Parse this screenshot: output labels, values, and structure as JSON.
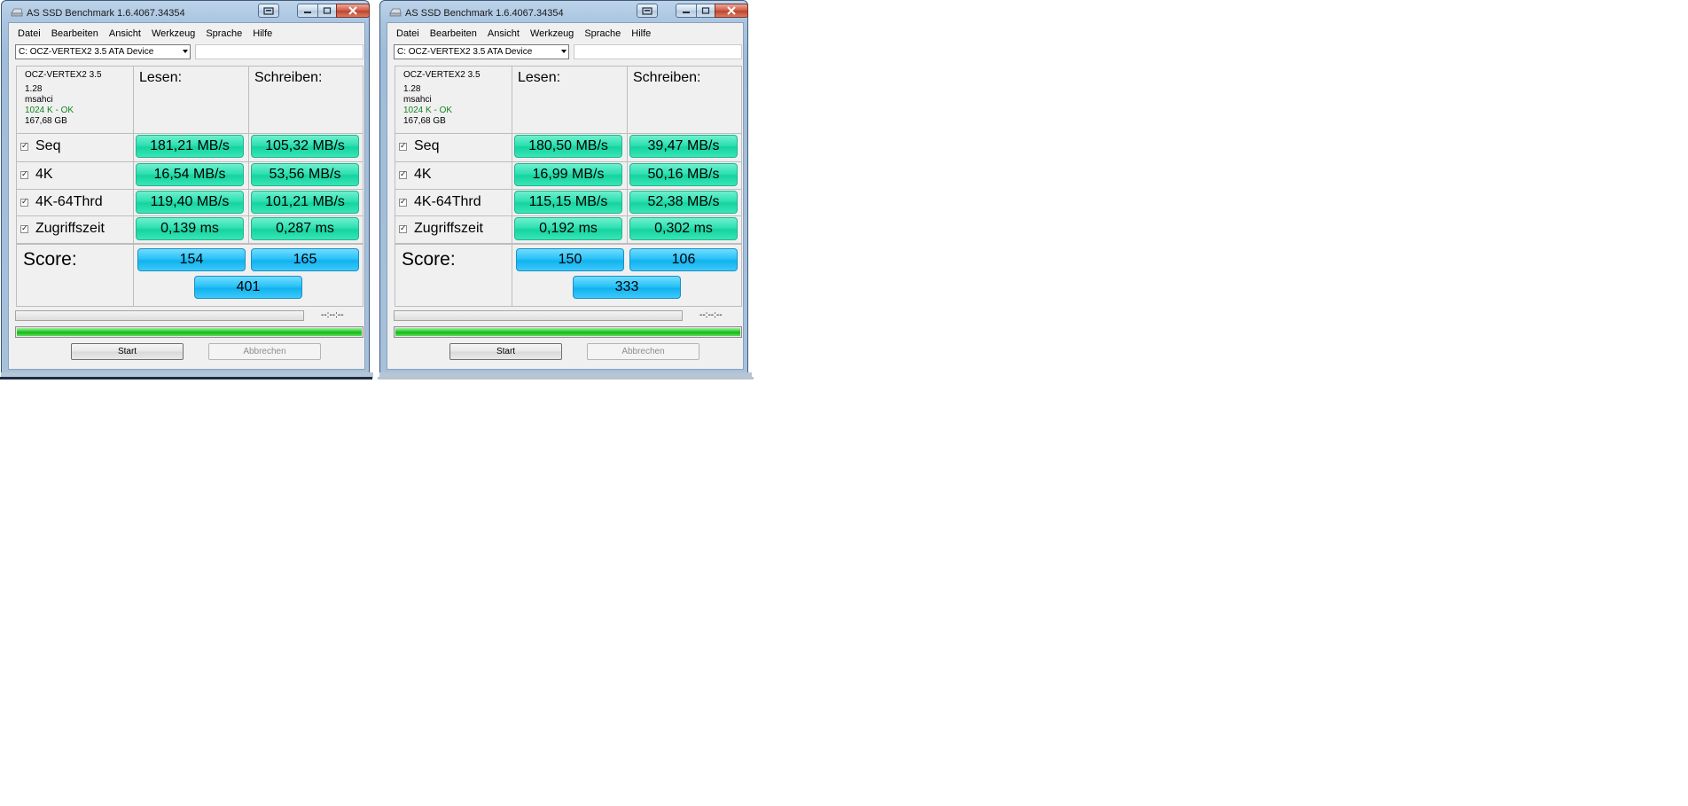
{
  "windows": [
    {
      "title": "AS SSD Benchmark 1.6.4067.34354",
      "menu": [
        "Datei",
        "Bearbeiten",
        "Ansicht",
        "Werkzeug",
        "Sprache",
        "Hilfe"
      ],
      "drive": "C: OCZ-VERTEX2 3.5 ATA Device",
      "info": {
        "model": "OCZ-VERTEX2 3.5",
        "firmware": "1.28",
        "driver": "msahci",
        "alignment": "1024 K - OK",
        "size": "167,68 GB"
      },
      "headers": {
        "read": "Lesen:",
        "write": "Schreiben:"
      },
      "rows": [
        {
          "label": "Seq",
          "read": "181,21 MB/s",
          "write": "105,32 MB/s"
        },
        {
          "label": "4K",
          "read": "16,54 MB/s",
          "write": "53,56 MB/s"
        },
        {
          "label": "4K-64Thrd",
          "read": "119,40 MB/s",
          "write": "101,21 MB/s"
        },
        {
          "label": "Zugriffszeit",
          "read": "0,139 ms",
          "write": "0,287 ms"
        }
      ],
      "score": {
        "label": "Score:",
        "read": "154",
        "write": "165",
        "total": "401"
      },
      "time": "--:--:--",
      "progress": 1.0,
      "start": "Start",
      "cancel": "Abbrechen"
    },
    {
      "title": "AS SSD Benchmark 1.6.4067.34354",
      "menu": [
        "Datei",
        "Bearbeiten",
        "Ansicht",
        "Werkzeug",
        "Sprache",
        "Hilfe"
      ],
      "drive": "C: OCZ-VERTEX2 3.5 ATA Device",
      "info": {
        "model": "OCZ-VERTEX2 3.5",
        "firmware": "1.28",
        "driver": "msahci",
        "alignment": "1024 K - OK",
        "size": "167,68 GB"
      },
      "headers": {
        "read": "Lesen:",
        "write": "Schreiben:"
      },
      "rows": [
        {
          "label": "Seq",
          "read": "180,50 MB/s",
          "write": "39,47 MB/s"
        },
        {
          "label": "4K",
          "read": "16,99 MB/s",
          "write": "50,16 MB/s"
        },
        {
          "label": "4K-64Thrd",
          "read": "115,15 MB/s",
          "write": "52,38 MB/s"
        },
        {
          "label": "Zugriffszeit",
          "read": "0,192 ms",
          "write": "0,302 ms"
        }
      ],
      "score": {
        "label": "Score:",
        "read": "150",
        "write": "106",
        "total": "333"
      },
      "time": "--:--:--",
      "progress": 1.0,
      "start": "Start",
      "cancel": "Abbrechen"
    }
  ],
  "colors": {
    "result_green": "#2fe0b2",
    "score_blue": "#2cc2f7",
    "progress_green": "#22c322",
    "ok_green": "#12831f"
  },
  "icons": {
    "app": "hard-drive-icon",
    "minimize": "minimize-icon",
    "maximize": "maximize-icon",
    "close": "close-icon",
    "restore": "restore-icon",
    "dropdown": "chevron-down-icon"
  }
}
